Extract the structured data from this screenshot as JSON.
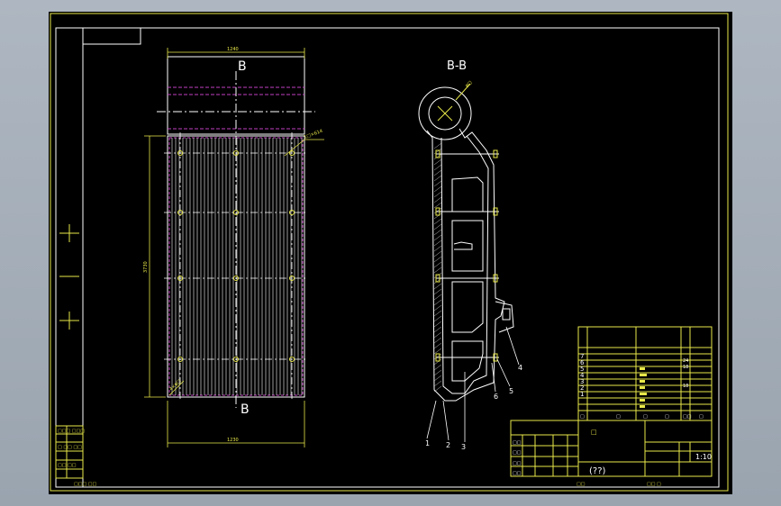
{
  "colors": {
    "background": "#000000",
    "frame": "#e8e84a",
    "outline": "#ffffff",
    "hidden_line": "#c040c0",
    "center_line": "#ffffff"
  },
  "drawing": {
    "front_view": {
      "section_label_top": "B",
      "section_label_bottom": "B",
      "dim_top_width": "1240",
      "dim_bottom_width": "1230",
      "dim_height": "3730",
      "note_top_right": "1□×614",
      "note_bottom_left": "4×φ□"
    },
    "side_view": {
      "title": "B-B",
      "dim_circle": "φ□",
      "part_numbers": [
        "1",
        "2",
        "3",
        "4",
        "5",
        "6"
      ]
    },
    "left_strip": {
      "rows": [
        "□□□ □□□",
        "□ □□ □□",
        "□□ □□"
      ],
      "bottom_text": "□□□ □□"
    },
    "bom": {
      "row_numbers": [
        "7",
        "6",
        "5",
        "4",
        "3",
        "2",
        "1"
      ],
      "quantities": [
        "24",
        "18",
        "",
        "",
        "18",
        "",
        ""
      ],
      "header": [
        "□",
        "□",
        "□",
        "□",
        "□□",
        "□"
      ]
    },
    "title_block": {
      "drawing_name": "(??)",
      "scale": "1:10",
      "label_material": "□",
      "row_labels": [
        "□□",
        "□□",
        "□□",
        "□□"
      ],
      "bottom_mid": "□□",
      "bottom_right": "□□ □"
    }
  }
}
